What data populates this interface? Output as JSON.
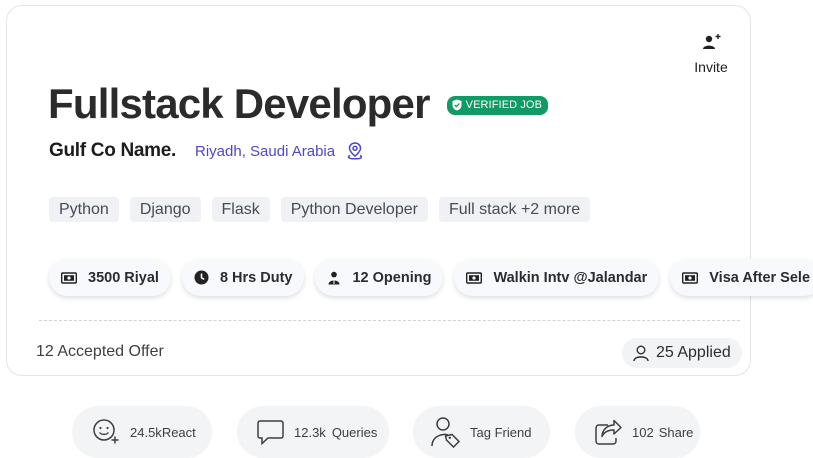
{
  "invite": {
    "label": "Invite"
  },
  "job": {
    "title": "Fullstack Developer",
    "badge": "VERIFIED JOB",
    "company": "Gulf Co Name.",
    "location": "Riyadh, Saudi Arabia"
  },
  "tags": [
    "Python",
    "Django",
    "Flask",
    "Python Developer",
    "Full stack +2 more"
  ],
  "chips": [
    {
      "icon": "money-icon",
      "label": "3500 Riyal"
    },
    {
      "icon": "clock-icon",
      "label": "8 Hrs Duty"
    },
    {
      "icon": "person-icon",
      "label": "12 Opening"
    },
    {
      "icon": "money-icon",
      "label": "Walkin Intv @Jalandar"
    },
    {
      "icon": "money-icon",
      "label": "Visa After Sele"
    }
  ],
  "footer": {
    "accepted": "12 Accepted Offer",
    "applied": "25 Applied"
  },
  "actions": {
    "react": {
      "count": "24.5k",
      "label": "React"
    },
    "queries": {
      "count": "12.3k",
      "label": "Queries"
    },
    "tag": {
      "label": "Tag Friend"
    },
    "share": {
      "count": "102",
      "label": "Share"
    }
  },
  "colors": {
    "verified_badge": "#0f9b63",
    "location_link": "#4f46c8"
  }
}
